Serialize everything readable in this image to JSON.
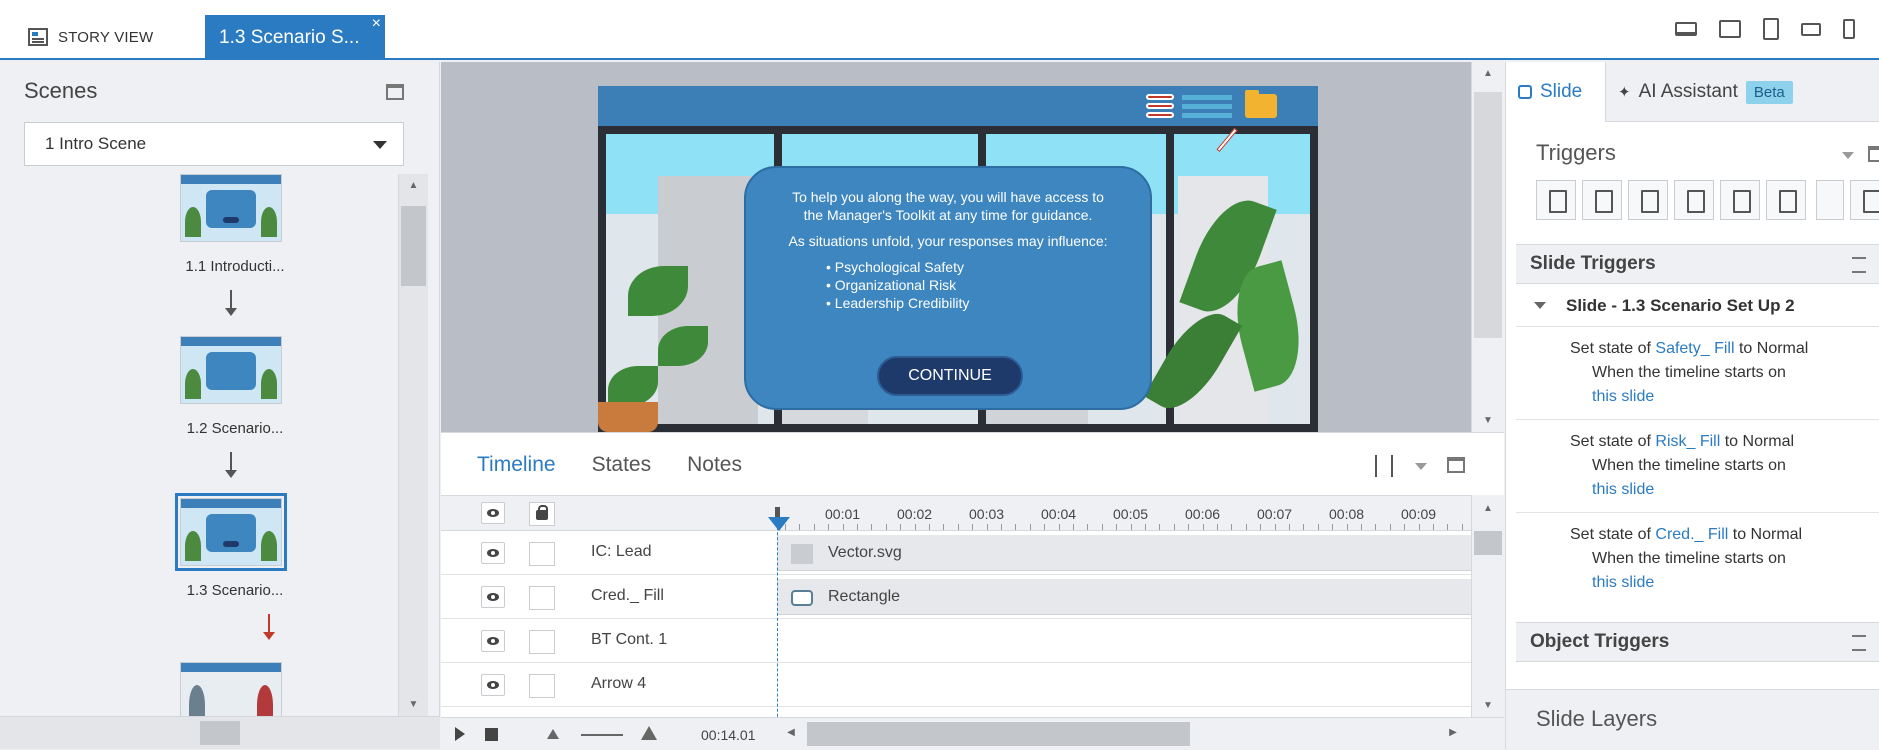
{
  "tabs": {
    "story_view": "STORY VIEW",
    "active_tab": "1.3 Scenario S...",
    "close": "×"
  },
  "left_panel": {
    "title": "Scenes",
    "scene_select": "1 Intro Scene",
    "slides": [
      {
        "label": "1.1 Introducti..."
      },
      {
        "label": "1.2 Scenario..."
      },
      {
        "label": "1.3 Scenario..."
      }
    ]
  },
  "slide_content": {
    "paragraph1": "To help you along the way, you will have access to the Manager's Toolkit at any time for guidance.",
    "paragraph2": "As situations unfold, your responses may influence:",
    "bullets": [
      "Psychological Safety",
      "Organizational Risk",
      "Leadership Credibility"
    ],
    "button": "CONTINUE"
  },
  "timeline": {
    "tabs": [
      "Timeline",
      "States",
      "Notes"
    ],
    "ruler": [
      "00:01",
      "00:02",
      "00:03",
      "00:04",
      "00:05",
      "00:06",
      "00:07",
      "00:08",
      "00:09"
    ],
    "rows": [
      {
        "name": "IC: Lead",
        "bar": "Vector.svg"
      },
      {
        "name": "Cred._ Fill",
        "bar": "Rectangle"
      },
      {
        "name": "BT Cont. 1",
        "bar": ""
      },
      {
        "name": "Arrow 4",
        "bar": ""
      }
    ],
    "duration": "00:14.01"
  },
  "right_panel": {
    "tab_slide": "Slide",
    "tab_ai": "AI Assistant",
    "beta": "Beta",
    "triggers_title": "Triggers",
    "slide_triggers": "Slide Triggers",
    "group_title": "Slide - 1.3 Scenario Set Up 2",
    "triggers": [
      {
        "prefix": "Set state of ",
        "object": "Safety_ Fill",
        "mid": " to Normal",
        "when": "When the ",
        "event": "timeline starts",
        "on": " on",
        "target": "this slide"
      },
      {
        "prefix": "Set state of ",
        "object": "Risk_ Fill",
        "mid": " to Normal",
        "when": "When the ",
        "event": "timeline starts",
        "on": " on",
        "target": "this slide"
      },
      {
        "prefix": "Set state of ",
        "object": "Cred._ Fill",
        "mid": " to Normal",
        "when": "When the ",
        "event": "timeline starts",
        "on": " on",
        "target": "this slide"
      }
    ],
    "object_triggers": "Object Triggers",
    "slide_layers": "Slide Layers"
  },
  "colors": {
    "accent": "#2b7bc2",
    "slide_header": "#3b7fb6",
    "modal": "#3d86c0",
    "button": "#1d3a6b"
  }
}
